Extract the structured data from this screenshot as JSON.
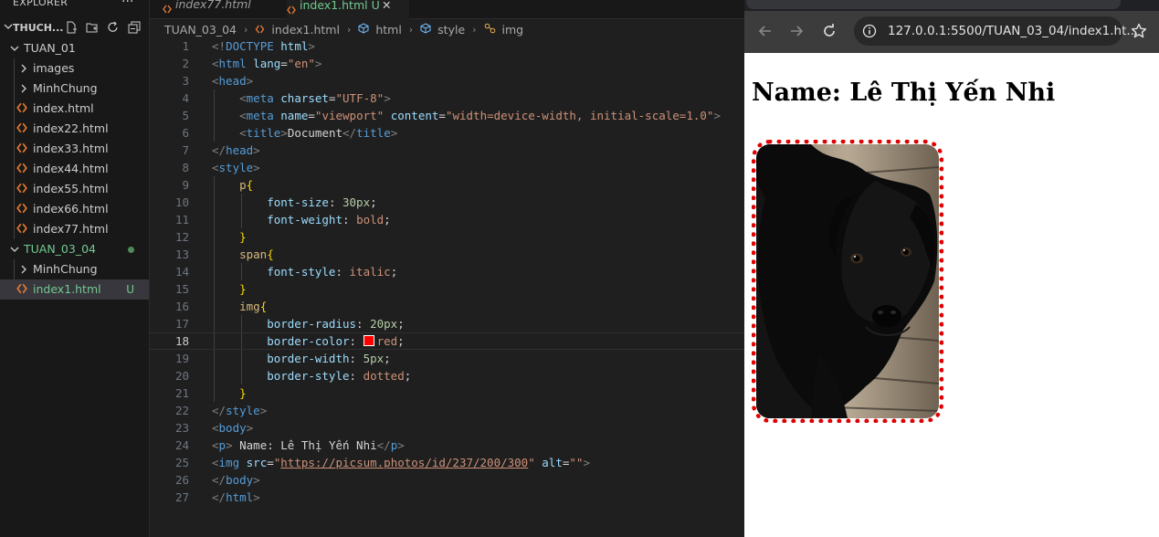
{
  "sidebar": {
    "title": "EXPLORER",
    "more": "···",
    "workspace_name": "THUCH...",
    "items": [
      {
        "label": "TUAN_01",
        "type": "folder-open",
        "color": "#cccccc"
      },
      {
        "label": "images",
        "type": "folder",
        "color": "#cccccc"
      },
      {
        "label": "MinhChung",
        "type": "folder",
        "color": "#cccccc"
      },
      {
        "label": "index.html",
        "type": "file",
        "color": "#cccccc"
      },
      {
        "label": "index22.html",
        "type": "file",
        "color": "#cccccc"
      },
      {
        "label": "index33.html",
        "type": "file",
        "color": "#cccccc"
      },
      {
        "label": "index44.html",
        "type": "file",
        "color": "#cccccc"
      },
      {
        "label": "index55.html",
        "type": "file",
        "color": "#cccccc"
      },
      {
        "label": "index66.html",
        "type": "file",
        "color": "#cccccc"
      },
      {
        "label": "index77.html",
        "type": "file",
        "color": "#cccccc"
      },
      {
        "label": "TUAN_03_04",
        "type": "folder-open",
        "color": "#73c991"
      },
      {
        "label": "MinhChung",
        "type": "folder",
        "color": "#cccccc"
      },
      {
        "label": "index1.html",
        "type": "file",
        "color": "#73c991",
        "badge": "U"
      }
    ]
  },
  "tabs": [
    {
      "label": "index77.html"
    },
    {
      "label": "index1.html",
      "badge": "U",
      "close": "✕"
    }
  ],
  "breadcrumb": [
    "TUAN_03_04",
    "index1.html",
    "html",
    "style",
    "img"
  ],
  "code_lines": [
    {
      "n": "1",
      "t": [
        [
          "<!",
          "c-br"
        ],
        [
          "DOCTYPE ",
          "c-tag"
        ],
        [
          "html",
          "c-attr"
        ],
        [
          ">",
          "c-br"
        ]
      ]
    },
    {
      "n": "2",
      "t": [
        [
          "<",
          "c-br"
        ],
        [
          "html ",
          "c-tag"
        ],
        [
          "lang",
          "c-attr"
        ],
        [
          "=",
          "c-punc"
        ],
        [
          "\"en\"",
          "c-str"
        ],
        [
          ">",
          "c-br"
        ]
      ]
    },
    {
      "n": "3",
      "t": [
        [
          "<",
          "c-br"
        ],
        [
          "head",
          "c-tag"
        ],
        [
          ">",
          "c-br"
        ]
      ]
    },
    {
      "n": "4",
      "t": [
        [
          "    <",
          "c-br"
        ],
        [
          "meta ",
          "c-tag"
        ],
        [
          "charset",
          "c-attr"
        ],
        [
          "=",
          "c-punc"
        ],
        [
          "\"UTF-8\"",
          "c-str"
        ],
        [
          ">",
          "c-br"
        ]
      ]
    },
    {
      "n": "5",
      "t": [
        [
          "    <",
          "c-br"
        ],
        [
          "meta ",
          "c-tag"
        ],
        [
          "name",
          "c-attr"
        ],
        [
          "=",
          "c-punc"
        ],
        [
          "\"viewport\" ",
          "c-str"
        ],
        [
          "content",
          "c-attr"
        ],
        [
          "=",
          "c-punc"
        ],
        [
          "\"width=device-width, initial-scale=1.0\"",
          "c-str"
        ],
        [
          ">",
          "c-br"
        ]
      ]
    },
    {
      "n": "6",
      "t": [
        [
          "    <",
          "c-br"
        ],
        [
          "title",
          "c-tag"
        ],
        [
          ">",
          "c-br"
        ],
        [
          "Document",
          "c-txt"
        ],
        [
          "</",
          "c-br"
        ],
        [
          "title",
          "c-tag"
        ],
        [
          ">",
          "c-br"
        ]
      ]
    },
    {
      "n": "7",
      "t": [
        [
          "</",
          "c-br"
        ],
        [
          "head",
          "c-tag"
        ],
        [
          ">",
          "c-br"
        ]
      ]
    },
    {
      "n": "8",
      "t": [
        [
          "<",
          "c-br"
        ],
        [
          "style",
          "c-tag"
        ],
        [
          ">",
          "c-br"
        ]
      ]
    },
    {
      "n": "9",
      "t": [
        [
          "    p",
          "c-sel"
        ],
        [
          "{",
          "c-brace"
        ]
      ]
    },
    {
      "n": "10",
      "t": [
        [
          "        font-size",
          "c-prop"
        ],
        [
          ": ",
          "c-punc"
        ],
        [
          "30px",
          "c-num"
        ],
        [
          ";",
          "c-punc"
        ]
      ]
    },
    {
      "n": "11",
      "t": [
        [
          "        font-weight",
          "c-prop"
        ],
        [
          ": ",
          "c-punc"
        ],
        [
          "bold",
          "c-val"
        ],
        [
          ";",
          "c-punc"
        ]
      ]
    },
    {
      "n": "12",
      "t": [
        [
          "    }",
          "c-brace"
        ]
      ]
    },
    {
      "n": "13",
      "t": [
        [
          "    span",
          "c-sel"
        ],
        [
          "{",
          "c-brace"
        ]
      ]
    },
    {
      "n": "14",
      "t": [
        [
          "        font-style",
          "c-prop"
        ],
        [
          ": ",
          "c-punc"
        ],
        [
          "italic",
          "c-val"
        ],
        [
          ";",
          "c-punc"
        ]
      ]
    },
    {
      "n": "15",
      "t": [
        [
          "    }",
          "c-brace"
        ]
      ]
    },
    {
      "n": "16",
      "t": [
        [
          "    img",
          "c-sel"
        ],
        [
          "{",
          "c-brace"
        ]
      ]
    },
    {
      "n": "17",
      "t": [
        [
          "        border-radius",
          "c-prop"
        ],
        [
          ": ",
          "c-punc"
        ],
        [
          "20px",
          "c-num"
        ],
        [
          ";",
          "c-punc"
        ]
      ]
    },
    {
      "n": "18",
      "current": true,
      "t": [
        [
          "        border-color",
          "c-prop"
        ],
        [
          ": ",
          "c-punc"
        ],
        [
          "SWATCH",
          "swatch"
        ],
        [
          "red",
          "c-val"
        ],
        [
          ";",
          "c-punc"
        ]
      ]
    },
    {
      "n": "19",
      "t": [
        [
          "        border-width",
          "c-prop"
        ],
        [
          ": ",
          "c-punc"
        ],
        [
          "5px",
          "c-num"
        ],
        [
          ";",
          "c-punc"
        ]
      ]
    },
    {
      "n": "20",
      "t": [
        [
          "        border-style",
          "c-prop"
        ],
        [
          ": ",
          "c-punc"
        ],
        [
          "dotted",
          "c-val"
        ],
        [
          ";",
          "c-punc"
        ]
      ]
    },
    {
      "n": "21",
      "t": [
        [
          "    }",
          "c-brace"
        ]
      ]
    },
    {
      "n": "22",
      "t": [
        [
          "</",
          "c-br"
        ],
        [
          "style",
          "c-tag"
        ],
        [
          ">",
          "c-br"
        ]
      ]
    },
    {
      "n": "23",
      "t": [
        [
          "<",
          "c-br"
        ],
        [
          "body",
          "c-tag"
        ],
        [
          ">",
          "c-br"
        ]
      ]
    },
    {
      "n": "24",
      "t": [
        [
          "<",
          "c-br"
        ],
        [
          "p",
          "c-tag"
        ],
        [
          "> ",
          "c-br"
        ],
        [
          "Name: Lê Thị Yến Nhi",
          "c-txt"
        ],
        [
          "</",
          "c-br"
        ],
        [
          "p",
          "c-tag"
        ],
        [
          ">",
          "c-br"
        ]
      ]
    },
    {
      "n": "25",
      "t": [
        [
          "<",
          "c-br"
        ],
        [
          "img ",
          "c-tag"
        ],
        [
          "src",
          "c-attr"
        ],
        [
          "=",
          "c-punc"
        ],
        [
          "\"",
          "c-str"
        ],
        [
          "https://picsum.photos/id/237/200/300",
          "c-link"
        ],
        [
          "\" ",
          "c-str"
        ],
        [
          "alt",
          "c-attr"
        ],
        [
          "=",
          "c-punc"
        ],
        [
          "\"\"",
          "c-str"
        ],
        [
          ">",
          "c-br"
        ]
      ]
    },
    {
      "n": "26",
      "t": [
        [
          "</",
          "c-br"
        ],
        [
          "body",
          "c-tag"
        ],
        [
          ">",
          "c-br"
        ]
      ]
    },
    {
      "n": "27",
      "t": [
        [
          "</",
          "c-br"
        ],
        [
          "html",
          "c-tag"
        ],
        [
          ">",
          "c-br"
        ]
      ]
    }
  ],
  "browser": {
    "url": "127.0.0.1:5500/TUAN_03_04/index1.ht...",
    "page_heading": "Name: Lê Thị Yến Nhi",
    "image_description_icon": "puppy-photo"
  },
  "colors": {
    "accent": "#0078d4",
    "untracked": "#73c991",
    "image_border": "#e00000"
  }
}
